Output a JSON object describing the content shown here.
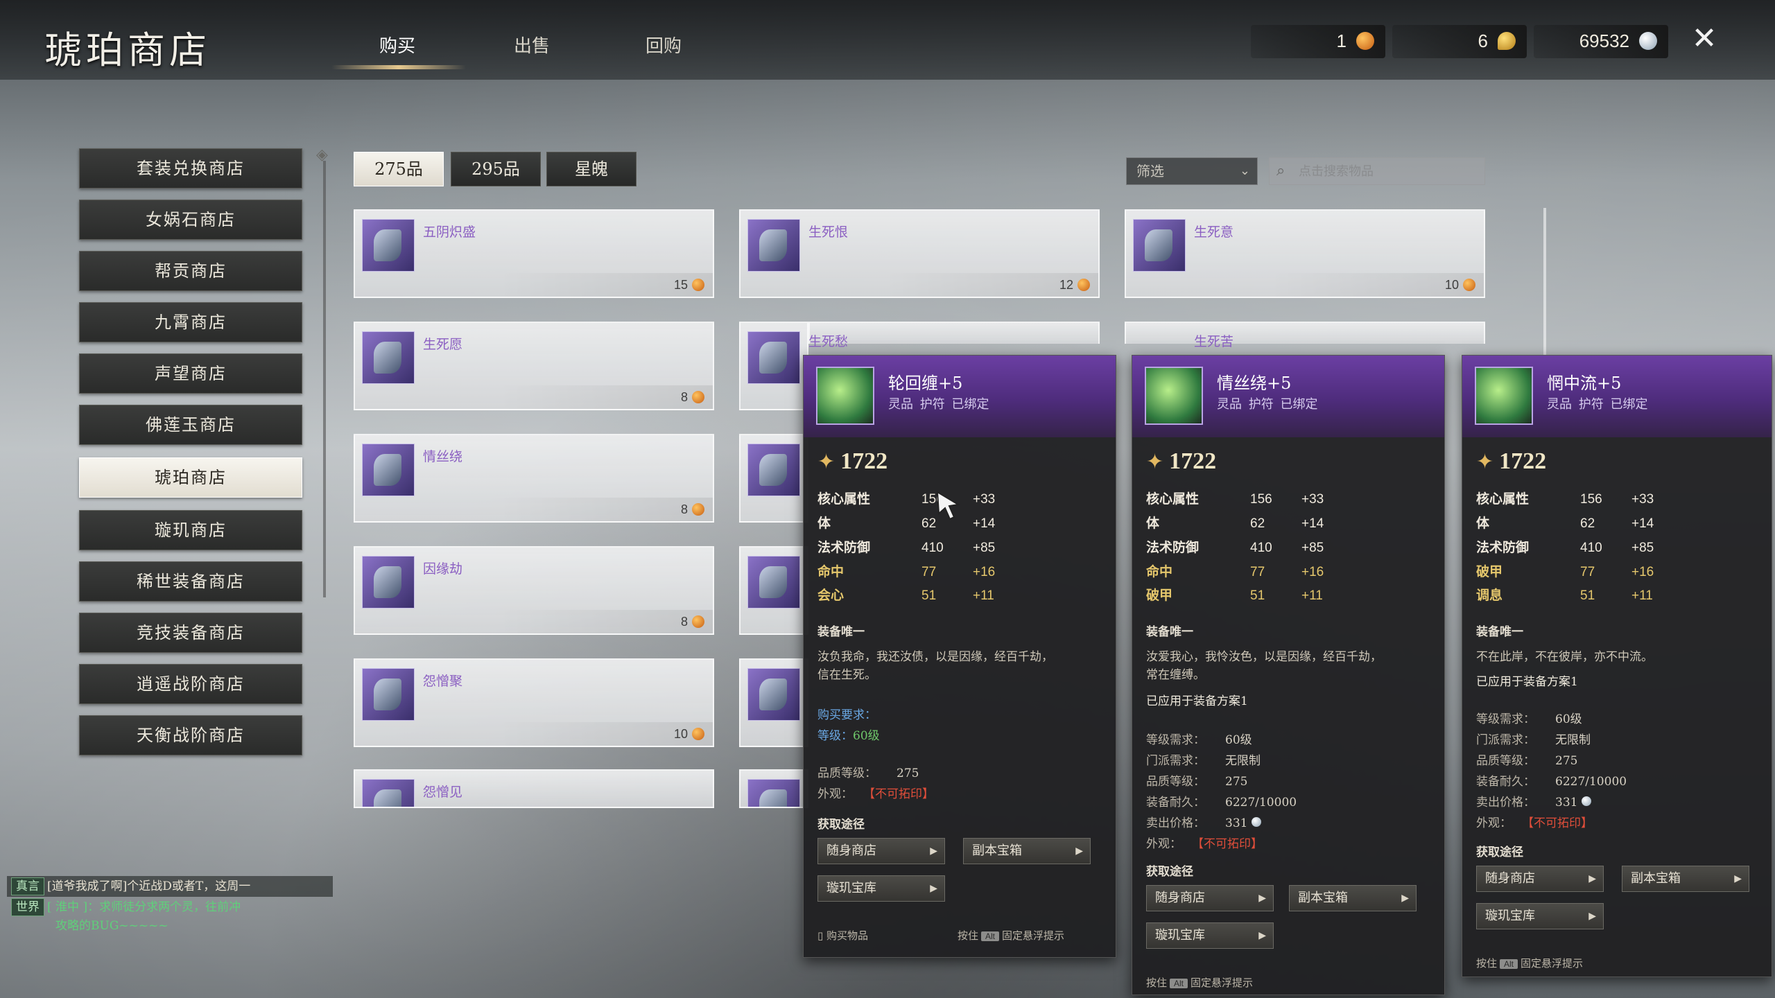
{
  "window": {
    "title": "琥珀商店",
    "close_icon": "close-icon"
  },
  "main_tabs": [
    {
      "label": "购买",
      "active": true
    },
    {
      "label": "出售",
      "active": false
    },
    {
      "label": "回购",
      "active": false
    }
  ],
  "currencies": [
    {
      "value": "1",
      "icon": "amber-icon"
    },
    {
      "value": "6",
      "icon": "gold-icon"
    },
    {
      "value": "69532",
      "icon": "silver-icon"
    }
  ],
  "sidebar": {
    "items": [
      {
        "label": "套装兑换商店"
      },
      {
        "label": "女娲石商店"
      },
      {
        "label": "帮贡商店"
      },
      {
        "label": "九霄商店"
      },
      {
        "label": "声望商店"
      },
      {
        "label": "佛莲玉商店"
      },
      {
        "label": "琥珀商店",
        "active": true
      },
      {
        "label": "璇玑商店"
      },
      {
        "label": "稀世装备商店"
      },
      {
        "label": "竞技装备商店"
      },
      {
        "label": "逍遥战阶商店"
      },
      {
        "label": "天衡战阶商店"
      }
    ]
  },
  "subtabs": [
    {
      "label": "275品",
      "active": true
    },
    {
      "label": "295品",
      "active": false
    },
    {
      "label": "星魄",
      "active": false
    }
  ],
  "filter": {
    "label": "筛选"
  },
  "search": {
    "placeholder": "点击搜索物品"
  },
  "items": [
    {
      "name": "五阴炽盛",
      "price": "15"
    },
    {
      "name": "生死恨",
      "price": "12"
    },
    {
      "name": "生死意",
      "price": "10"
    },
    {
      "name": "生死愿",
      "price": "8"
    },
    {
      "name": "生死愁",
      "price": ""
    },
    {
      "name": "生死苦",
      "price": ""
    },
    {
      "name": "情丝绕",
      "price": "8"
    },
    {
      "name": "因缘劫",
      "price": "8"
    },
    {
      "name": "怨憎聚",
      "price": "10"
    },
    {
      "name": "怨憎见",
      "price": ""
    }
  ],
  "tooltips": [
    {
      "title": "轮回缠+5",
      "subtitle": "灵品 护符 已绑定",
      "score": "1722",
      "stats": [
        {
          "label": "核心属性",
          "value": "156",
          "bonus": "+33"
        },
        {
          "label": "体",
          "value": "62",
          "bonus": "+14"
        },
        {
          "label": "法术防御",
          "value": "410",
          "bonus": "+85"
        },
        {
          "label": "命中",
          "value": "77",
          "bonus": "+16"
        },
        {
          "label": "会心",
          "value": "51",
          "bonus": "+11"
        }
      ],
      "unique": "装备唯一",
      "flavor1": "汝负我命，我还汝债，以是因缘，经百千劫，",
      "flavor2": "信在生死。",
      "req_title": "购买要求：",
      "req_level_label": "等级：",
      "req_level_value": "60级",
      "quality_label": "品质等级：",
      "quality_value": "275",
      "appearance_label": "外观：",
      "appearance_value": "【不可拓印】",
      "source_title": "获取途径",
      "sources": [
        "随身商店",
        "副本宝箱",
        "璇玑宝库"
      ],
      "footer_left": "购买物品",
      "footer_hint_pre": "按住",
      "footer_key": "Alt",
      "footer_hint_post": "固定悬浮提示"
    },
    {
      "title": "情丝绕+5",
      "subtitle": "灵品 护符 已绑定",
      "score": "1722",
      "stats": [
        {
          "label": "核心属性",
          "value": "156",
          "bonus": "+33"
        },
        {
          "label": "体",
          "value": "62",
          "bonus": "+14"
        },
        {
          "label": "法术防御",
          "value": "410",
          "bonus": "+85"
        },
        {
          "label": "命中",
          "value": "77",
          "bonus": "+16"
        },
        {
          "label": "破甲",
          "value": "51",
          "bonus": "+11"
        }
      ],
      "unique": "装备唯一",
      "flavor1": "汝爱我心，我怜汝色，以是因缘，经百千劫，",
      "flavor2": "常在缠缚。",
      "applied": "已应用于装备方案1",
      "details": [
        {
          "k": "等级需求：",
          "v": "60级"
        },
        {
          "k": "门派需求：",
          "v": "无限制"
        },
        {
          "k": "品质等级：",
          "v": "275"
        },
        {
          "k": "装备耐久：",
          "v": "6227/10000"
        },
        {
          "k": "卖出价格：",
          "v": "331"
        },
        {
          "k": "外观：",
          "v": "【不可拓印】"
        }
      ],
      "source_title": "获取途径",
      "sources": [
        "随身商店",
        "副本宝箱",
        "璇玑宝库"
      ],
      "footer_hint_pre": "按住",
      "footer_key": "Alt",
      "footer_hint_post": "固定悬浮提示"
    },
    {
      "title": "惘中流+5",
      "subtitle": "灵品 护符 已绑定",
      "score": "1722",
      "stats": [
        {
          "label": "核心属性",
          "value": "156",
          "bonus": "+33"
        },
        {
          "label": "体",
          "value": "62",
          "bonus": "+14"
        },
        {
          "label": "法术防御",
          "value": "410",
          "bonus": "+85"
        },
        {
          "label": "破甲",
          "value": "77",
          "bonus": "+16"
        },
        {
          "label": "调息",
          "value": "51",
          "bonus": "+11"
        }
      ],
      "unique": "装备唯一",
      "flavor1": "不在此岸，不在彼岸，亦不中流。",
      "applied": "已应用于装备方案1",
      "details": [
        {
          "k": "等级需求：",
          "v": "60级"
        },
        {
          "k": "门派需求：",
          "v": "无限制"
        },
        {
          "k": "品质等级：",
          "v": "275"
        },
        {
          "k": "装备耐久：",
          "v": "6227/10000"
        },
        {
          "k": "卖出价格：",
          "v": "331"
        },
        {
          "k": "外观：",
          "v": "【不可拓印】"
        }
      ],
      "source_title": "获取途径",
      "sources": [
        "随身商店",
        "副本宝箱",
        "璇玑宝库"
      ],
      "footer_hint_pre": "按住",
      "footer_key": "Alt",
      "footer_hint_post": "固定悬浮提示"
    }
  ],
  "chat": {
    "line1_badge": "真言",
    "line1_text": "[道爷我成了啊]个近战D或者T，这周一",
    "line2_channel": "世界",
    "line2_text": "[ 淮中 ]：求师徒分求两个灵，往前冲",
    "line3_text": "攻略的BUG~~~~~"
  },
  "colors": {
    "accent_gold": "#e5c76c",
    "item_purple": "#8b5fc2",
    "warn_red": "#e04e3a",
    "tooltip_header": "#6b3fa3"
  }
}
